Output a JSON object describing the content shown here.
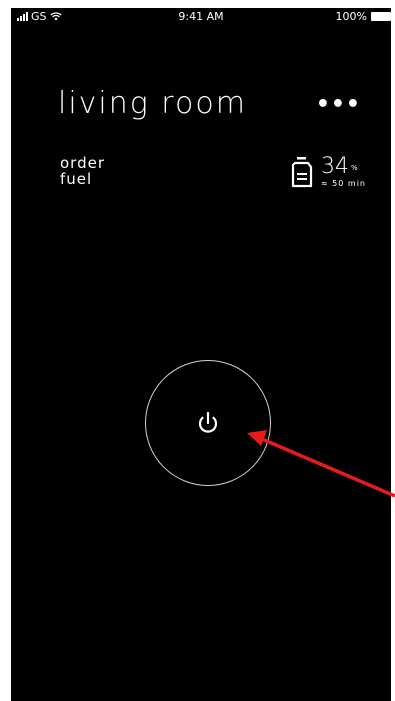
{
  "status_bar": {
    "carrier": "GS",
    "time": "9:41 AM",
    "battery_percent": "100%"
  },
  "header": {
    "title": "living room",
    "more_label": "•••"
  },
  "order_fuel": {
    "line1": "order",
    "line2": "fuel"
  },
  "fuel_status": {
    "percent": "34",
    "percent_unit": "%",
    "remaining_time": "≈ 50 min",
    "icon": "fuel-can-icon"
  },
  "power": {
    "icon": "power-icon"
  },
  "annotation": {
    "color": "#e81b1b"
  }
}
